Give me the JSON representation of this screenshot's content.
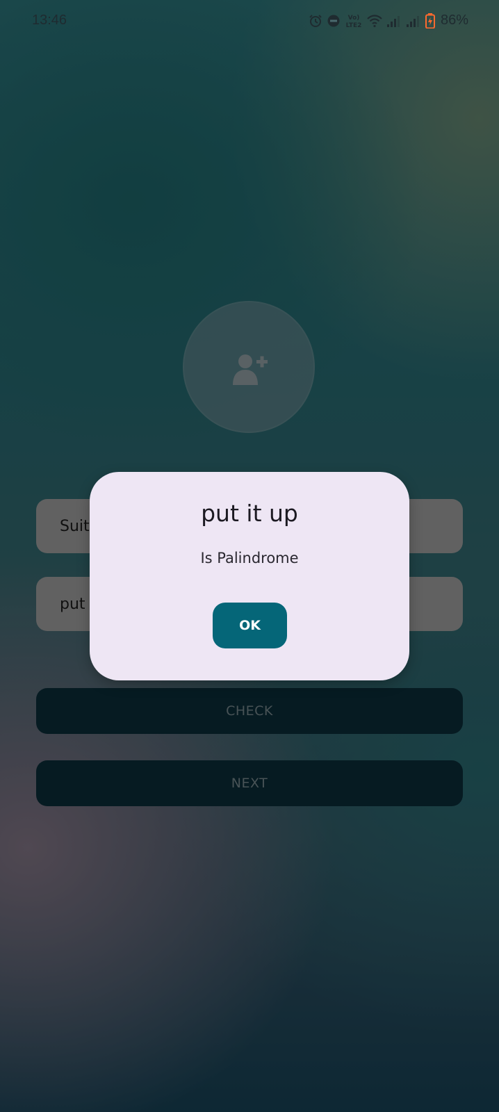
{
  "status_bar": {
    "time": "13:46",
    "battery_percent": "86%",
    "network_label": "Vo) LTE2",
    "icons": [
      "alarm-icon",
      "do-not-disturb-icon",
      "volte-icon",
      "wifi-icon",
      "signal-icon",
      "signal-icon",
      "battery-charging-icon"
    ],
    "battery_color": "#ff6a2e"
  },
  "avatar": {
    "icon": "add-person-icon"
  },
  "form": {
    "name_value": "Suit",
    "sentence_value": "put"
  },
  "buttons": {
    "check_label": "CHECK",
    "next_label": "NEXT"
  },
  "dialog": {
    "title": "put it up",
    "message": "Is Palindrome",
    "ok_label": "OK"
  },
  "colors": {
    "dialog_background": "#eee6f4",
    "ok_button": "#056678",
    "primary_button": "#0b2f3c"
  }
}
